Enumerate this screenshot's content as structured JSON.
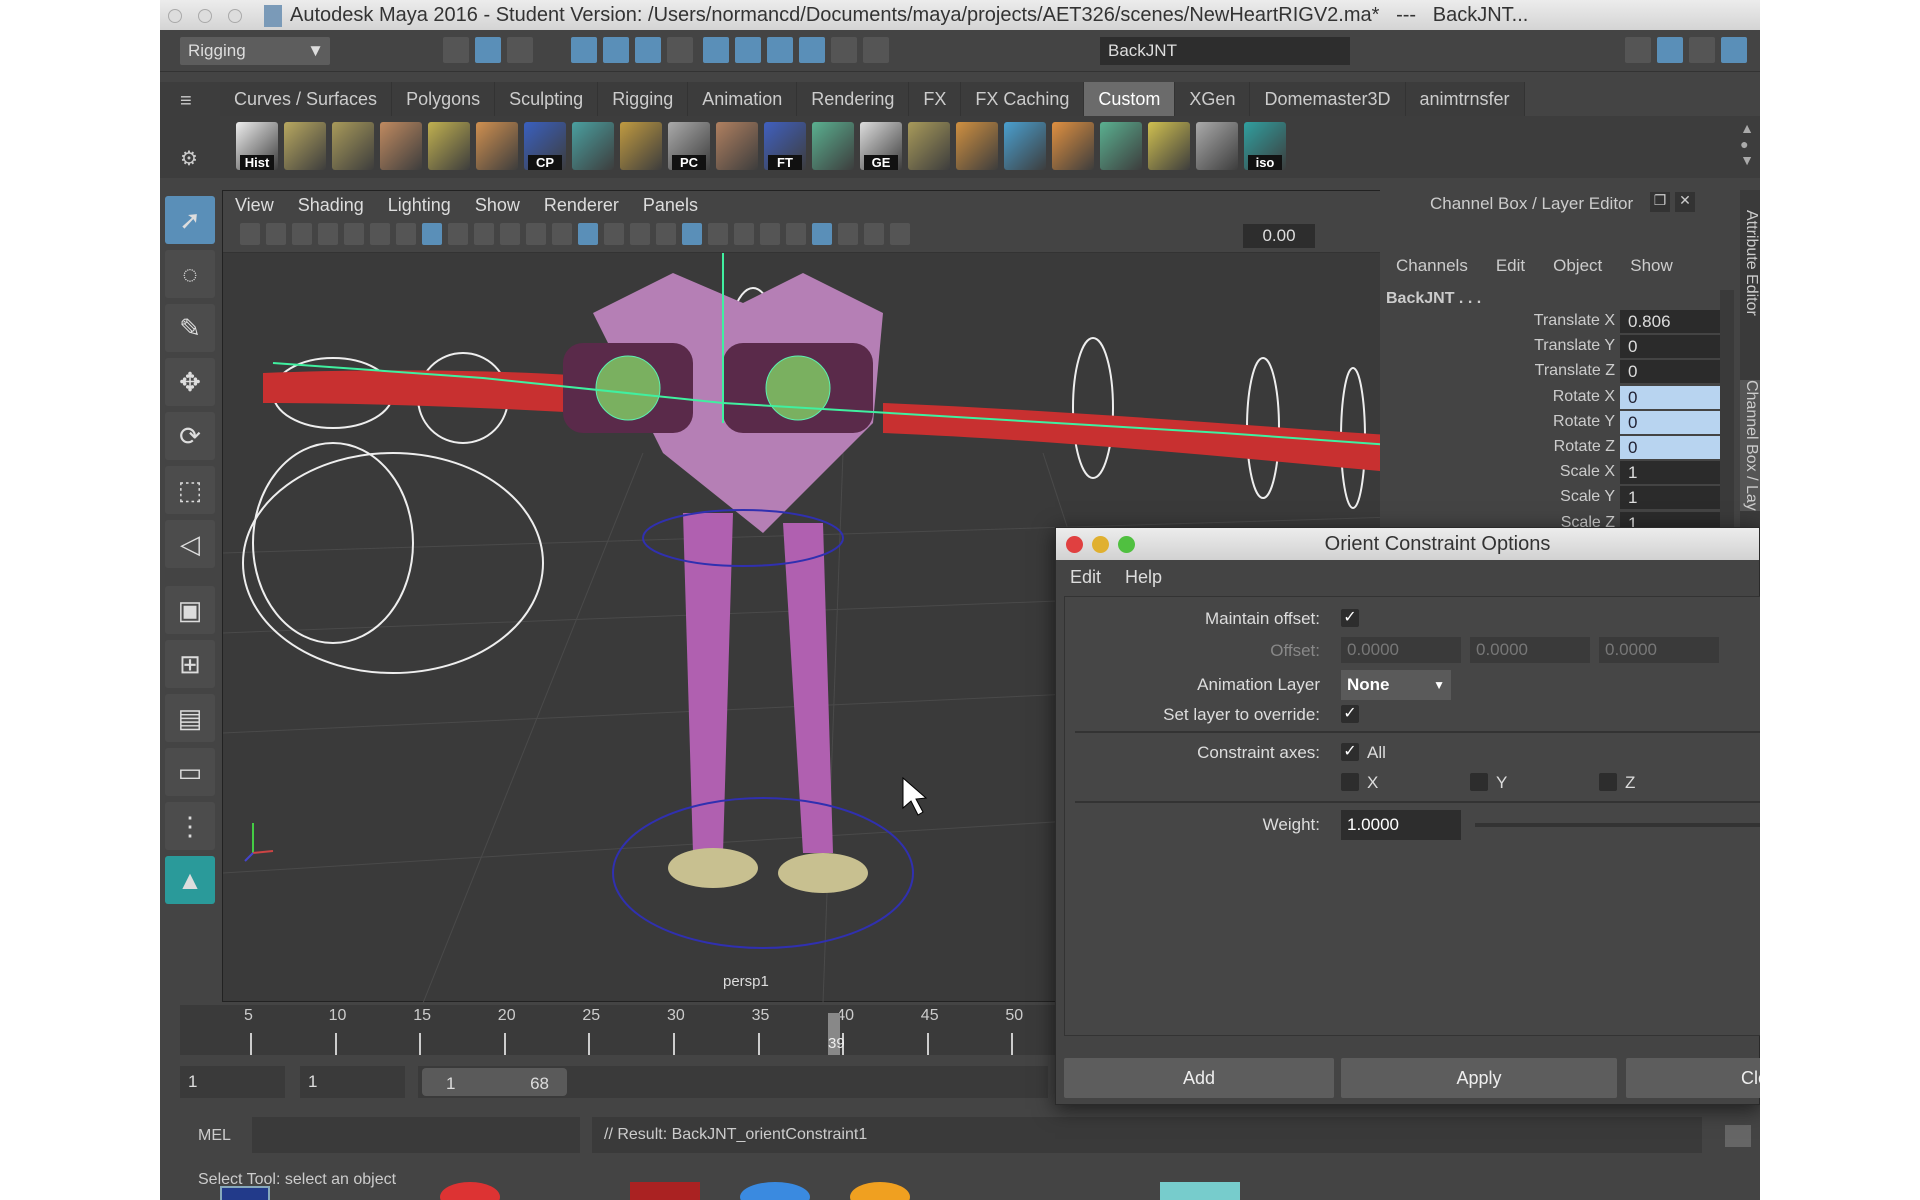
{
  "window": {
    "title": "Autodesk Maya 2016 - Student Version: /Users/normancd/Documents/maya/projects/AET326/scenes/NewHeartRIGV2.ma*   ---   BackJNT..."
  },
  "status_line": {
    "menu_set": "Rigging",
    "object_name": "BackJNT"
  },
  "shelf": {
    "tabs": [
      "Curves / Surfaces",
      "Polygons",
      "Sculpting",
      "Rigging",
      "Animation",
      "Rendering",
      "FX",
      "FX Caching",
      "Custom",
      "XGen",
      "Domemaster3D",
      "animtrnsfer"
    ],
    "active_tab": "Custom",
    "icons": [
      {
        "name": "hist",
        "label": "Hist",
        "color": "#eeeeee"
      },
      {
        "name": "lattice",
        "label": "",
        "color": "#b8a860"
      },
      {
        "name": "plane",
        "label": "",
        "color": "#a89a5a"
      },
      {
        "name": "curve",
        "label": "",
        "color": "#c08a60"
      },
      {
        "name": "grid-surface",
        "label": "",
        "color": "#c0b050"
      },
      {
        "name": "box",
        "label": "",
        "color": "#d09050"
      },
      {
        "name": "cp",
        "label": "CP",
        "color": "#3a60c0"
      },
      {
        "name": "window",
        "label": "",
        "color": "#4aa0a0"
      },
      {
        "name": "lattice-2",
        "label": "",
        "color": "#c09a40"
      },
      {
        "name": "pc",
        "label": "PC",
        "color": "#aaaaaa"
      },
      {
        "name": "pen",
        "label": "",
        "color": "#b08060"
      },
      {
        "name": "ft",
        "label": "FT",
        "color": "#4060c0"
      },
      {
        "name": "checker",
        "label": "",
        "color": "#5ab090"
      },
      {
        "name": "ge",
        "label": "GE",
        "color": "#dddddd"
      },
      {
        "name": "plane-2",
        "label": "",
        "color": "#a89a5a"
      },
      {
        "name": "bars",
        "label": "",
        "color": "#d09040"
      },
      {
        "name": "brush",
        "label": "",
        "color": "#4aa0d0"
      },
      {
        "name": "diamond",
        "label": "",
        "color": "#e09040"
      },
      {
        "name": "checker-2",
        "label": "",
        "color": "#5ab090"
      },
      {
        "name": "target",
        "label": "",
        "color": "#d0c050"
      },
      {
        "name": "frame",
        "label": "",
        "color": "#aaaaaa"
      },
      {
        "name": "iso",
        "label": "iso",
        "color": "#30a0a0"
      }
    ]
  },
  "viewport": {
    "menu": [
      "View",
      "Shading",
      "Lighting",
      "Show",
      "Renderer",
      "Panels"
    ],
    "exposure": "0.00",
    "camera_label": "persp1"
  },
  "channel_box": {
    "title": "Channel Box / Layer Editor",
    "menu": [
      "Channels",
      "Edit",
      "Object",
      "Show"
    ],
    "object": "BackJNT . . .",
    "channels": [
      {
        "name": "Translate X",
        "value": "0.806",
        "highlight": false
      },
      {
        "name": "Translate Y",
        "value": "0",
        "highlight": false
      },
      {
        "name": "Translate Z",
        "value": "0",
        "highlight": false
      },
      {
        "name": "Rotate X",
        "value": "0",
        "highlight": true
      },
      {
        "name": "Rotate Y",
        "value": "0",
        "highlight": true
      },
      {
        "name": "Rotate Z",
        "value": "0",
        "highlight": true
      },
      {
        "name": "Scale X",
        "value": "1",
        "highlight": false
      },
      {
        "name": "Scale Y",
        "value": "1",
        "highlight": false
      },
      {
        "name": "Scale Z",
        "value": "1",
        "highlight": false
      }
    ],
    "side_tabs": [
      "Attribute Editor",
      "Channel Box / Lay"
    ]
  },
  "dialog": {
    "title": "Orient Constraint Options",
    "menu": [
      "Edit",
      "Help"
    ],
    "maintain_offset_label": "Maintain offset:",
    "maintain_offset": true,
    "offset_label": "Offset:",
    "offset": [
      "0.0000",
      "0.0000",
      "0.0000"
    ],
    "anim_layer_label": "Animation Layer",
    "anim_layer": "None",
    "set_layer_label": "Set layer to override:",
    "set_layer": true,
    "axes_label": "Constraint axes:",
    "axes_all_label": "All",
    "axes_all": true,
    "axes": [
      {
        "label": "X",
        "checked": false
      },
      {
        "label": "Y",
        "checked": false
      },
      {
        "label": "Z",
        "checked": false
      }
    ],
    "weight_label": "Weight:",
    "weight": "1.0000",
    "buttons": [
      "Add",
      "Apply",
      "Close"
    ]
  },
  "timeline": {
    "ticks": [
      "5",
      "10",
      "15",
      "20",
      "25",
      "30",
      "35",
      "40",
      "45",
      "50"
    ],
    "current_frame": "39"
  },
  "range": {
    "start": "1",
    "playback_start": "1",
    "range_start": "1",
    "range_end": "68"
  },
  "command_line": {
    "language": "MEL",
    "result": "// Result: BackJNT_orientConstraint1"
  },
  "help_line": "Select Tool: select an object",
  "colors": {
    "highlight": "#5a8fb8",
    "channel_highlight": "#b8d4f0",
    "active_tab": "#6b6b6b"
  }
}
